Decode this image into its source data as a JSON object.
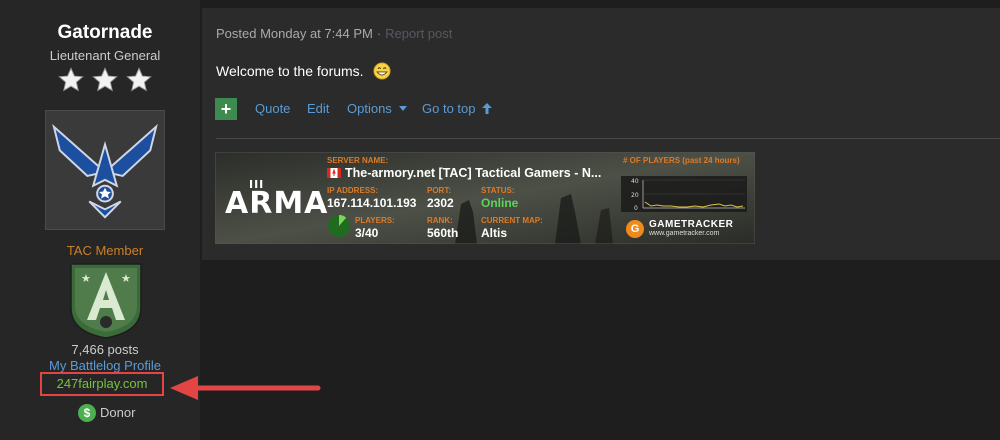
{
  "user": {
    "name": "Gatornade",
    "rank": "Lieutenant General",
    "group": "TAC Member",
    "posts": "7,466 posts",
    "battlelog_link": "My Battlelog Profile",
    "fairplay_link": "247fairplay.com",
    "donor": "Donor",
    "donor_symbol": "$"
  },
  "post": {
    "posted": "Posted Monday at 7:44 PM",
    "separator": "·",
    "report": "Report post",
    "message": "Welcome to the forums.",
    "actions": {
      "plus": "+",
      "quote": "Quote",
      "edit": "Edit",
      "options": "Options",
      "go_to_top": "Go to top"
    }
  },
  "signature": {
    "server_name_label": "SERVER NAME:",
    "server_name": "The-armory.net [TAC] Tactical Gamers - N...",
    "ip_label": "IP ADDRESS:",
    "ip": "167.114.101.193",
    "port_label": "PORT:",
    "port": "2302",
    "status_label": "STATUS:",
    "status": "Online",
    "players_label": "PLAYERS:",
    "players": "3/40",
    "rank_label": "RANK:",
    "rank": "560th",
    "map_label": "CURRENT MAP:",
    "map": "Altis",
    "graph_title": "# OF PLAYERS (past 24 hours)",
    "graph_ticks": [
      "40",
      "20",
      "0"
    ],
    "logo_text": "ARMA",
    "logo_sup": "III",
    "gt_name": "GAMETRACKER",
    "gt_url": "www.gametracker.com",
    "gt_symbol": "G"
  },
  "colors": {
    "accent_link": "#5b9bd5",
    "group_color": "#c8812a",
    "fairplay_color": "#7ac142",
    "highlight_red": "#e34545",
    "button_green": "#3e8b50"
  }
}
